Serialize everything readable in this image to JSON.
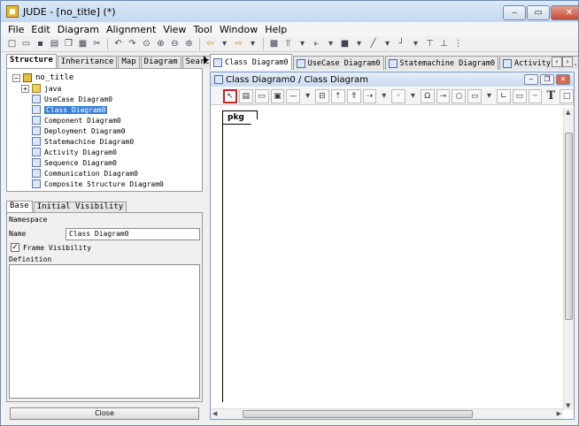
{
  "window": {
    "title": "JUDE - [no_title] (*)",
    "min": "‒",
    "max": "▭",
    "close": "✕"
  },
  "menu": [
    "File",
    "Edit",
    "Diagram",
    "Alignment",
    "View",
    "Tool",
    "Window",
    "Help"
  ],
  "toolbar_icons": [
    "new-icon",
    "open-icon",
    "save-icon",
    "print-icon",
    "copy-icon",
    "paste-icon",
    "cut-icon",
    "undo-icon",
    "redo-icon",
    "zoom-icon",
    "zoom-in-icon",
    "zoom-out-icon",
    "zoom-fit-icon",
    "back-icon",
    "forward-icon",
    "grid-icon",
    "align-top-icon",
    "align-left-icon",
    "fill-icon",
    "line-icon",
    "connector-icon",
    "tree-icon",
    "layout-icon",
    "arrange-icon"
  ],
  "left_tabs": [
    "Structure",
    "Inheritance",
    "Map",
    "Diagram",
    "Search"
  ],
  "tree": {
    "root": "no_title",
    "items": [
      {
        "label": "java",
        "icon": "folder-icon"
      },
      {
        "label": "UseCase Diagram0",
        "icon": "usecase-diagram-icon"
      },
      {
        "label": "Class Diagram0",
        "icon": "class-diagram-icon",
        "selected": true
      },
      {
        "label": "Component Diagram0",
        "icon": "component-diagram-icon"
      },
      {
        "label": "Deployment Diagram0",
        "icon": "deployment-diagram-icon"
      },
      {
        "label": "Statemachine Diagram0",
        "icon": "statemachine-diagram-icon"
      },
      {
        "label": "Activity Diagram0",
        "icon": "activity-diagram-icon"
      },
      {
        "label": "Sequence Diagram0",
        "icon": "sequence-diagram-icon"
      },
      {
        "label": "Communication Diagram0",
        "icon": "communication-diagram-icon"
      },
      {
        "label": "Composite Structure Diagram0",
        "icon": "composite-diagram-icon"
      }
    ]
  },
  "props": {
    "tabs": [
      "Base",
      "Initial Visibility"
    ],
    "namespace_label": "Namespace",
    "name_label": "Name",
    "name_value": "Class Diagram0",
    "frame_visibility_label": "Frame Visibility",
    "frame_visibility_checked": true,
    "definition_label": "Definition",
    "close_label": "Close"
  },
  "diagram_tabs": [
    "Class Diagram0",
    "UseCase Diagram0",
    "Statemachine Diagram0",
    "Activity Dia..."
  ],
  "diagram_window": {
    "title": "Class Diagram0 / Class Diagram",
    "frame_label": "pkg"
  },
  "diagram_tools": [
    "select-tool-icon",
    "class-tool-icon",
    "package-tool-icon",
    "subsystem-tool-icon",
    "association-tool-icon",
    "aggregation-tool-icon",
    "generalization-tool-icon",
    "realization-tool-icon",
    "dependency-tool-icon",
    "usage-tool-icon",
    "interface-tool-icon",
    "instance-tool-icon",
    "object-tool-icon",
    "note-tool-icon",
    "anchor-tool-icon",
    "rectangle-tool-icon",
    "dashed-line-tool-icon",
    "text-tool-icon",
    "frame-tool-icon"
  ]
}
